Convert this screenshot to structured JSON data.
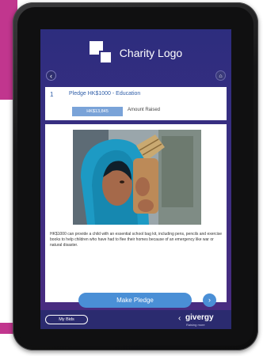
{
  "header": {
    "logo_text": "Charity Logo",
    "back_icon": "chevron-left-icon",
    "home_icon": "home-icon"
  },
  "pledge": {
    "number": "1",
    "title": "Pledge HK$1000 - Education",
    "amount_raised_value": "HK$13,845",
    "amount_raised_label": "Amount Raised"
  },
  "content": {
    "photo_icon": "photo-child-with-sack",
    "description": "HK$1000 can provide a child with an essential school bag kit, including pens, pencils and exercise books to help children who have had to flee their homes because of an emergency like war or natural disaster."
  },
  "actions": {
    "make_pledge": "Make Pledge",
    "next_icon": "chevron-right-icon"
  },
  "footer": {
    "my_bids": "My Bids",
    "brand_name": "givergy",
    "brand_tagline": "Raising more"
  },
  "colors": {
    "accent": "#c1368e",
    "screen_bg": "#2d2d7e",
    "button": "#4a8fd6",
    "title_text": "#2f5ea8"
  }
}
